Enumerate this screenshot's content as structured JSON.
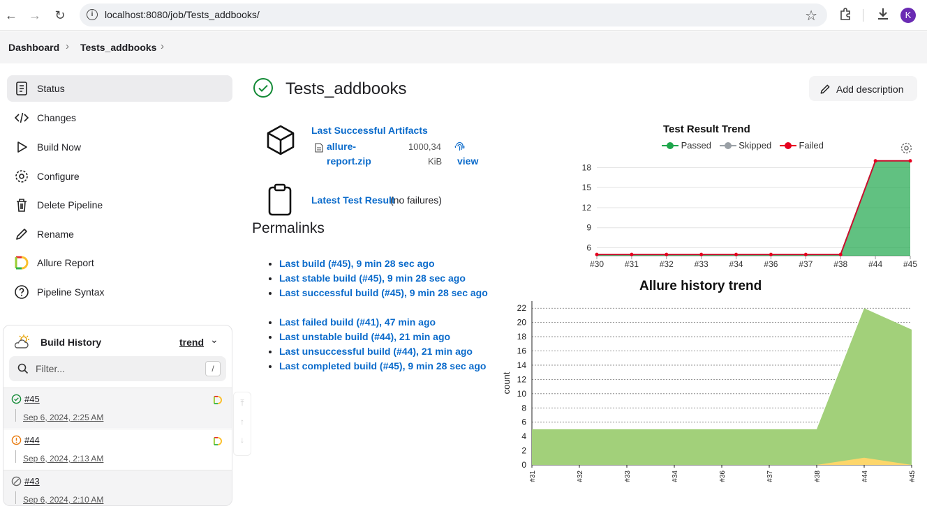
{
  "browser": {
    "url": "localhost:8080/job/Tests_addbooks/",
    "avatar_letter": "K"
  },
  "breadcrumb": [
    "Dashboard",
    "Tests_addbooks"
  ],
  "sidebar": {
    "items": [
      {
        "label": "Status",
        "icon": "status-icon"
      },
      {
        "label": "Changes",
        "icon": "code-icon"
      },
      {
        "label": "Build Now",
        "icon": "play-icon"
      },
      {
        "label": "Configure",
        "icon": "gear-icon"
      },
      {
        "label": "Delete Pipeline",
        "icon": "trash-icon"
      },
      {
        "label": "Rename",
        "icon": "pencil-icon"
      },
      {
        "label": "Allure Report",
        "icon": "allure-icon"
      },
      {
        "label": "Pipeline Syntax",
        "icon": "help-icon"
      }
    ]
  },
  "build_history": {
    "title": "Build History",
    "trend": "trend",
    "filter_placeholder": "Filter...",
    "filter_shortcut": "/",
    "builds": [
      {
        "number": "#45",
        "date": "Sep 6, 2024, 2:25 AM",
        "status": "success"
      },
      {
        "number": "#44",
        "date": "Sep 6, 2024, 2:13 AM",
        "status": "unstable"
      },
      {
        "number": "#43",
        "date": "Sep 6, 2024, 2:10 AM",
        "status": "aborted"
      }
    ]
  },
  "main": {
    "title": "Tests_addbooks",
    "add_description": "Add description",
    "artifacts": {
      "label": "Last Successful Artifacts",
      "file_line1": "allure-",
      "file_line2": "report.zip",
      "size_line1": "1000,34",
      "size_line2": "KiB",
      "view": "view"
    },
    "latest_test": {
      "label": "Latest Test Result",
      "note": "(no failures)"
    },
    "permalinks_title": "Permalinks",
    "permalinks_group1": [
      "Last build (#45), 9 min 28 sec ago",
      "Last stable build (#45), 9 min 28 sec ago",
      "Last successful build (#45), 9 min 28 sec ago"
    ],
    "permalinks_group2": [
      "Last failed build (#41), 47 min ago",
      "Last unstable build (#44), 21 min ago",
      "Last unsuccessful build (#44), 21 min ago",
      "Last completed build (#45), 9 min 28 sec ago"
    ]
  },
  "chart_data": [
    {
      "type": "area",
      "title": "Test Result Trend",
      "categories": [
        "#30",
        "#31",
        "#32",
        "#33",
        "#34",
        "#36",
        "#37",
        "#38",
        "#44",
        "#45"
      ],
      "yticks": [
        6,
        9,
        12,
        15,
        18
      ],
      "ylim": [
        4.8,
        19.5
      ],
      "series": [
        {
          "name": "Passed",
          "color": "#1ea64b",
          "values": [
            0,
            0,
            0,
            0,
            0,
            0,
            0,
            0,
            19,
            19
          ]
        },
        {
          "name": "Skipped",
          "color": "#9aa0a6",
          "values": [
            0,
            0,
            0,
            0,
            0,
            0,
            0,
            0,
            0,
            0
          ]
        },
        {
          "name": "Failed",
          "color": "#e6001f",
          "values": [
            5,
            5,
            5,
            5,
            5,
            5,
            5,
            5,
            0,
            0
          ]
        }
      ],
      "legend": "top-center",
      "grid": true
    },
    {
      "type": "area",
      "title": "Allure history trend",
      "ylabel": "count",
      "categories": [
        "#31",
        "#32",
        "#33",
        "#34",
        "#36",
        "#37",
        "#38",
        "#44",
        "#45"
      ],
      "yticks": [
        0,
        2,
        4,
        6,
        8,
        10,
        12,
        14,
        16,
        18,
        20,
        22
      ],
      "ylim": [
        0,
        23
      ],
      "series": [
        {
          "color": "#a2d07a",
          "values": [
            5,
            5,
            5,
            5,
            5,
            5,
            5,
            22,
            19
          ]
        },
        {
          "color": "#fdd66b",
          "values": [
            0,
            0,
            0,
            0,
            0,
            0,
            0,
            1,
            0
          ]
        }
      ],
      "grid": true
    }
  ]
}
